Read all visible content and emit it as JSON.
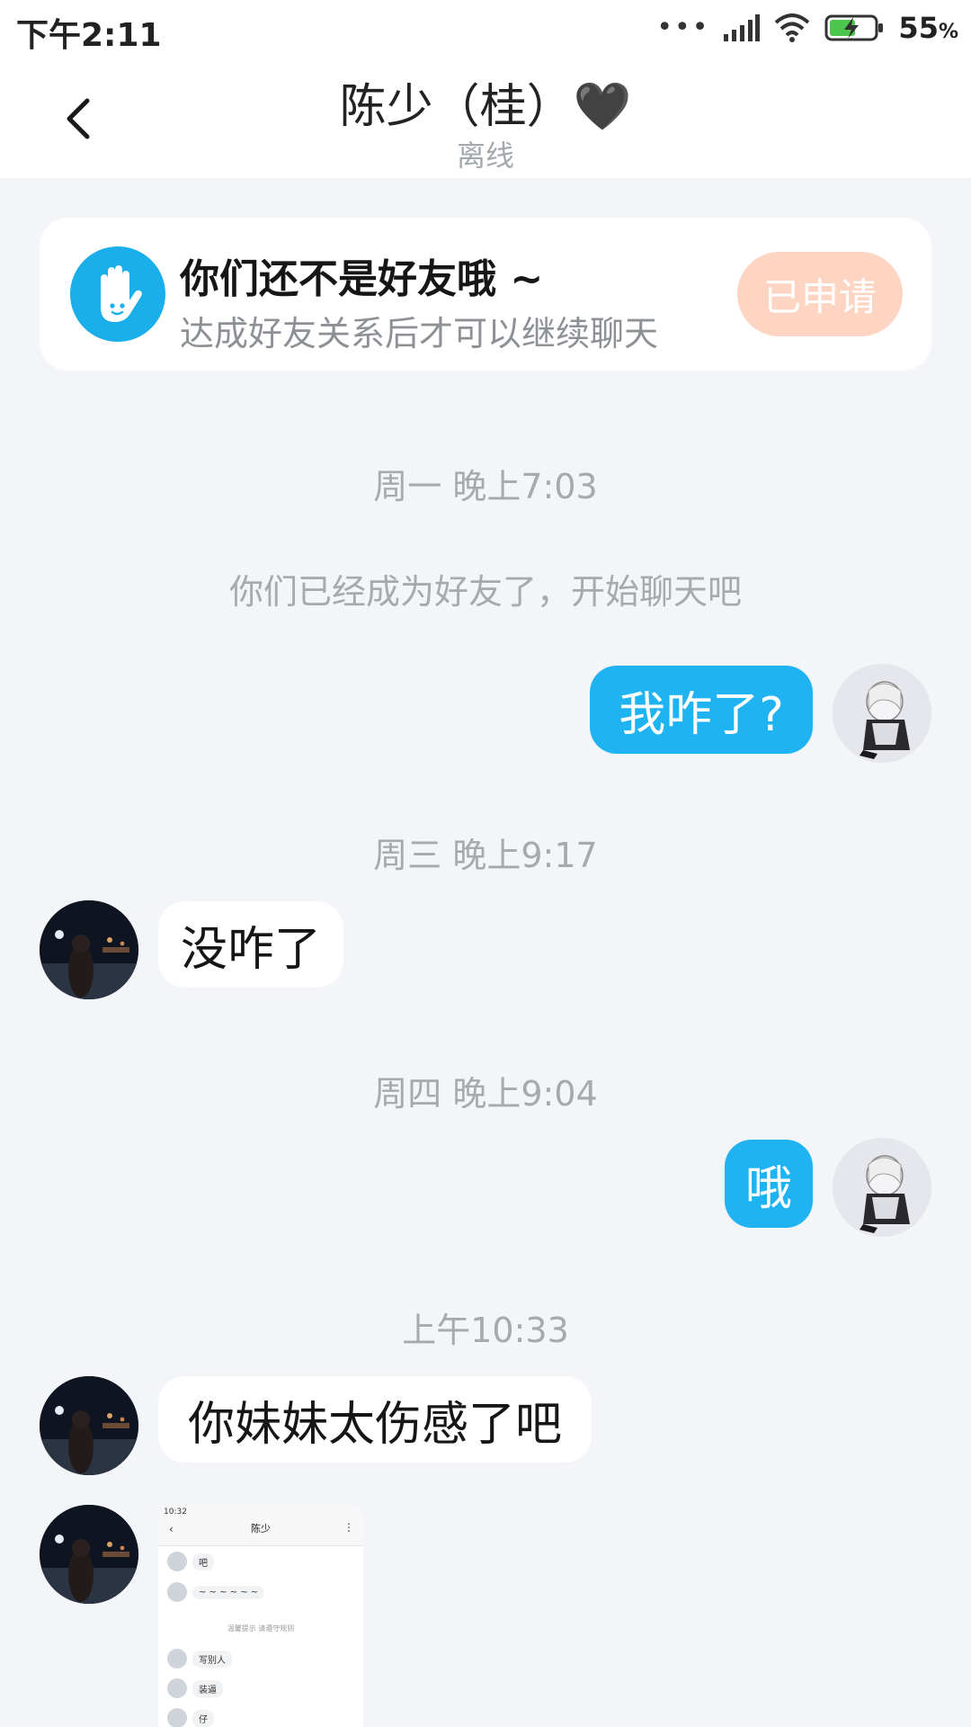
{
  "status_bar": {
    "time": "下午2:11",
    "signal_dots": "•••",
    "battery": "55",
    "battery_unit": "%"
  },
  "header": {
    "title": "陈少（桂）🖤",
    "subtitle": "离线"
  },
  "notice": {
    "title": "你们还不是好友哦 ~",
    "subtitle": "达成好友关系后才可以继续聊天",
    "button": "已申请"
  },
  "messages": {
    "ts1": "周一 晚上7:03",
    "sys1": "你们已经成为好友了，开始聊天吧",
    "m1": "我咋了?",
    "ts2": "周三 晚上9:17",
    "m2": "没咋了",
    "ts3": "周四 晚上9:04",
    "m3": "哦",
    "ts4": "上午10:33",
    "m4": "你妹妹太伤感了吧"
  },
  "screenshot_preview": {
    "time": "10:32",
    "title": "陈少",
    "row1": "吧",
    "row2": "~ ~ ~ ~ ~ ~",
    "tip": "温馨提示 请遵守规则",
    "row3": "写别人",
    "row4": "装逼",
    "row5": "仔"
  },
  "colors": {
    "accent_blue": "#1fb3f2",
    "apply_button_bg": "#fdd5c2",
    "background": "#f3f5f8"
  }
}
